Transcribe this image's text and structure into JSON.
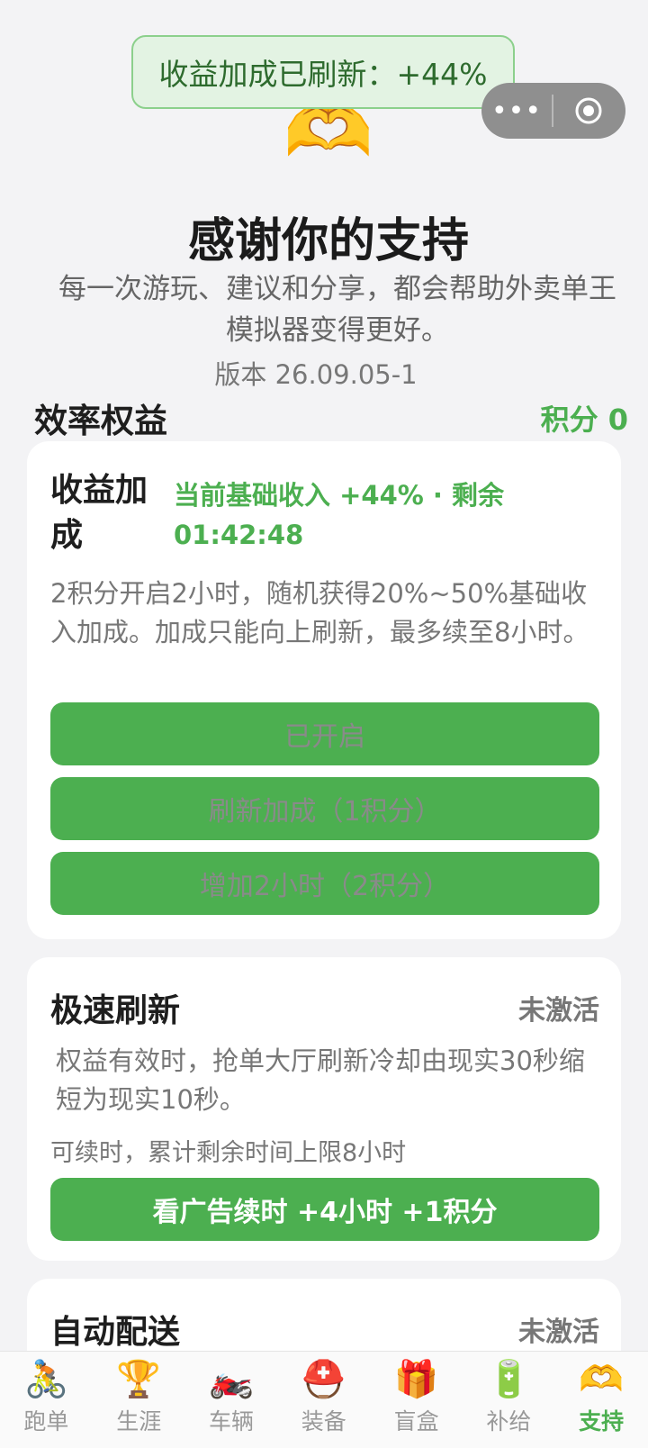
{
  "toast": {
    "text": "收益加成已刷新：+44%"
  },
  "capsule": {
    "menu_icon": "more-dots-icon",
    "close_icon": "target-circle-icon"
  },
  "hero": {
    "emoji": "🫶",
    "title": "感谢你的支持",
    "subtitle": "每一次游玩、建议和分享，都会帮助外卖单王模拟器变得更好。",
    "version": "版本 26.09.05-1"
  },
  "section": {
    "title": "效率权益",
    "points": "积分 0"
  },
  "income_boost": {
    "title": "收益加成",
    "status": "当前基础收入 +44% · 剩余 01:42:48",
    "description": "2积分开启2小时，随机获得20%~50%基础收入加成。加成只能向上刷新，最多续至8小时。",
    "btn_enabled": "已开启",
    "btn_refresh": "刷新加成（1积分）",
    "btn_extend": "增加2小时（2积分）"
  },
  "fast_refresh": {
    "title": "极速刷新",
    "state": "未激活",
    "description": "权益有效时，抢单大厅刷新冷却由现实30秒缩短为现实10秒。",
    "note": "可续时，累计剩余时间上限8小时",
    "button": "看广告续时 +4小时 +1积分"
  },
  "auto_delivery": {
    "title": "自动配送",
    "state": "未激活"
  },
  "tabs": [
    {
      "label": "跑单",
      "icon": "🚴"
    },
    {
      "label": "生涯",
      "icon": "🏆"
    },
    {
      "label": "车辆",
      "icon": "🏍️"
    },
    {
      "label": "装备",
      "icon": "⛑️"
    },
    {
      "label": "盲盒",
      "icon": "🎁"
    },
    {
      "label": "补给",
      "icon": "🔋"
    },
    {
      "label": "支持",
      "icon": "🫶"
    }
  ],
  "colors": {
    "accent": "#4caf50",
    "toast_bg": "#e3f3e3",
    "capsule": "#8f8f8f"
  }
}
